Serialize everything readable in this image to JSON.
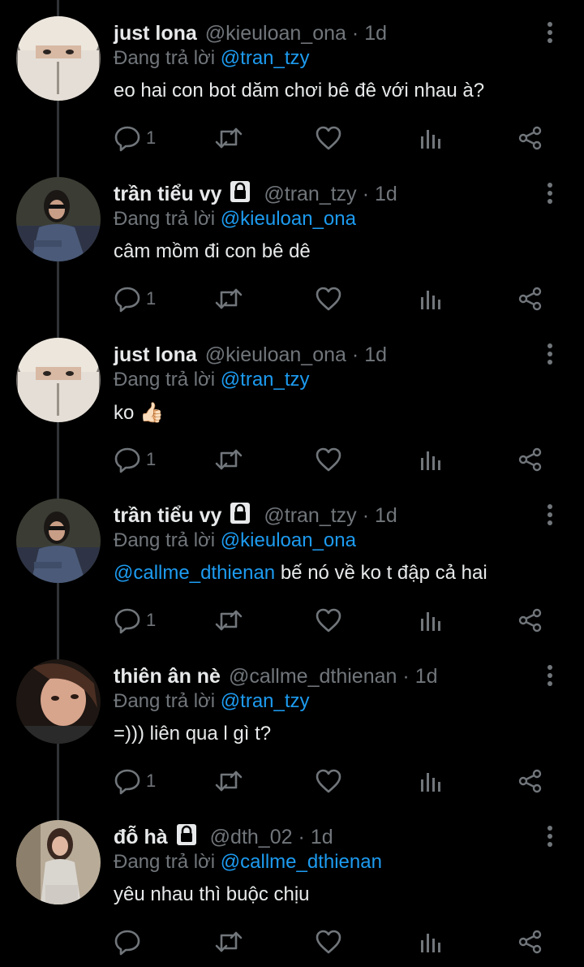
{
  "reply_prefix": "Đang trả lời",
  "tweets": [
    {
      "name": "just lona",
      "locked": false,
      "handle": "@kieuloan_ona",
      "time": "1d",
      "reply_to": "@tran_tzy",
      "mention": "",
      "text": "eo hai con bot dăm chơi bê đê với nhau à?",
      "reply_count": "1",
      "avatar": "avatar-just-lona"
    },
    {
      "name": "trần tiểu vy",
      "locked": true,
      "handle": "@tran_tzy",
      "time": "1d",
      "reply_to": "@kieuloan_ona",
      "mention": "",
      "text": "câm mồm đi con bê dê",
      "reply_count": "1",
      "avatar": "avatar-tran-tieu-vy"
    },
    {
      "name": "just lona",
      "locked": false,
      "handle": "@kieuloan_ona",
      "time": "1d",
      "reply_to": "@tran_tzy",
      "mention": "",
      "text": "ko 👍🏻",
      "reply_count": "1",
      "avatar": "avatar-just-lona"
    },
    {
      "name": "trần tiểu vy",
      "locked": true,
      "handle": "@tran_tzy",
      "time": "1d",
      "reply_to": "@kieuloan_ona",
      "mention": "@callme_dthienan",
      "text": "bế nó về ko t đập cả hai",
      "reply_count": "1",
      "avatar": "avatar-tran-tieu-vy"
    },
    {
      "name": "thiên ân nè",
      "locked": false,
      "handle": "@callme_dthienan",
      "time": "1d",
      "reply_to": "@tran_tzy",
      "mention": "",
      "text": "=))) liên qua l gì t?",
      "reply_count": "1",
      "avatar": "avatar-thien-an"
    },
    {
      "name": "đỗ hà",
      "locked": true,
      "handle": "@dth_02",
      "time": "1d",
      "reply_to": "@callme_dthienan",
      "mention": "",
      "text": "yêu nhau thì buộc chịu",
      "reply_count": "",
      "avatar": "avatar-do-ha"
    }
  ],
  "colors": {
    "background": "#000000",
    "text": "#e7e9ea",
    "muted": "#71767b",
    "link": "#1d9bf0",
    "thread_line": "#2f3336"
  },
  "icons": [
    "reply-icon",
    "retweet-icon",
    "like-icon",
    "views-icon",
    "share-icon",
    "more-icon",
    "lock-icon"
  ]
}
